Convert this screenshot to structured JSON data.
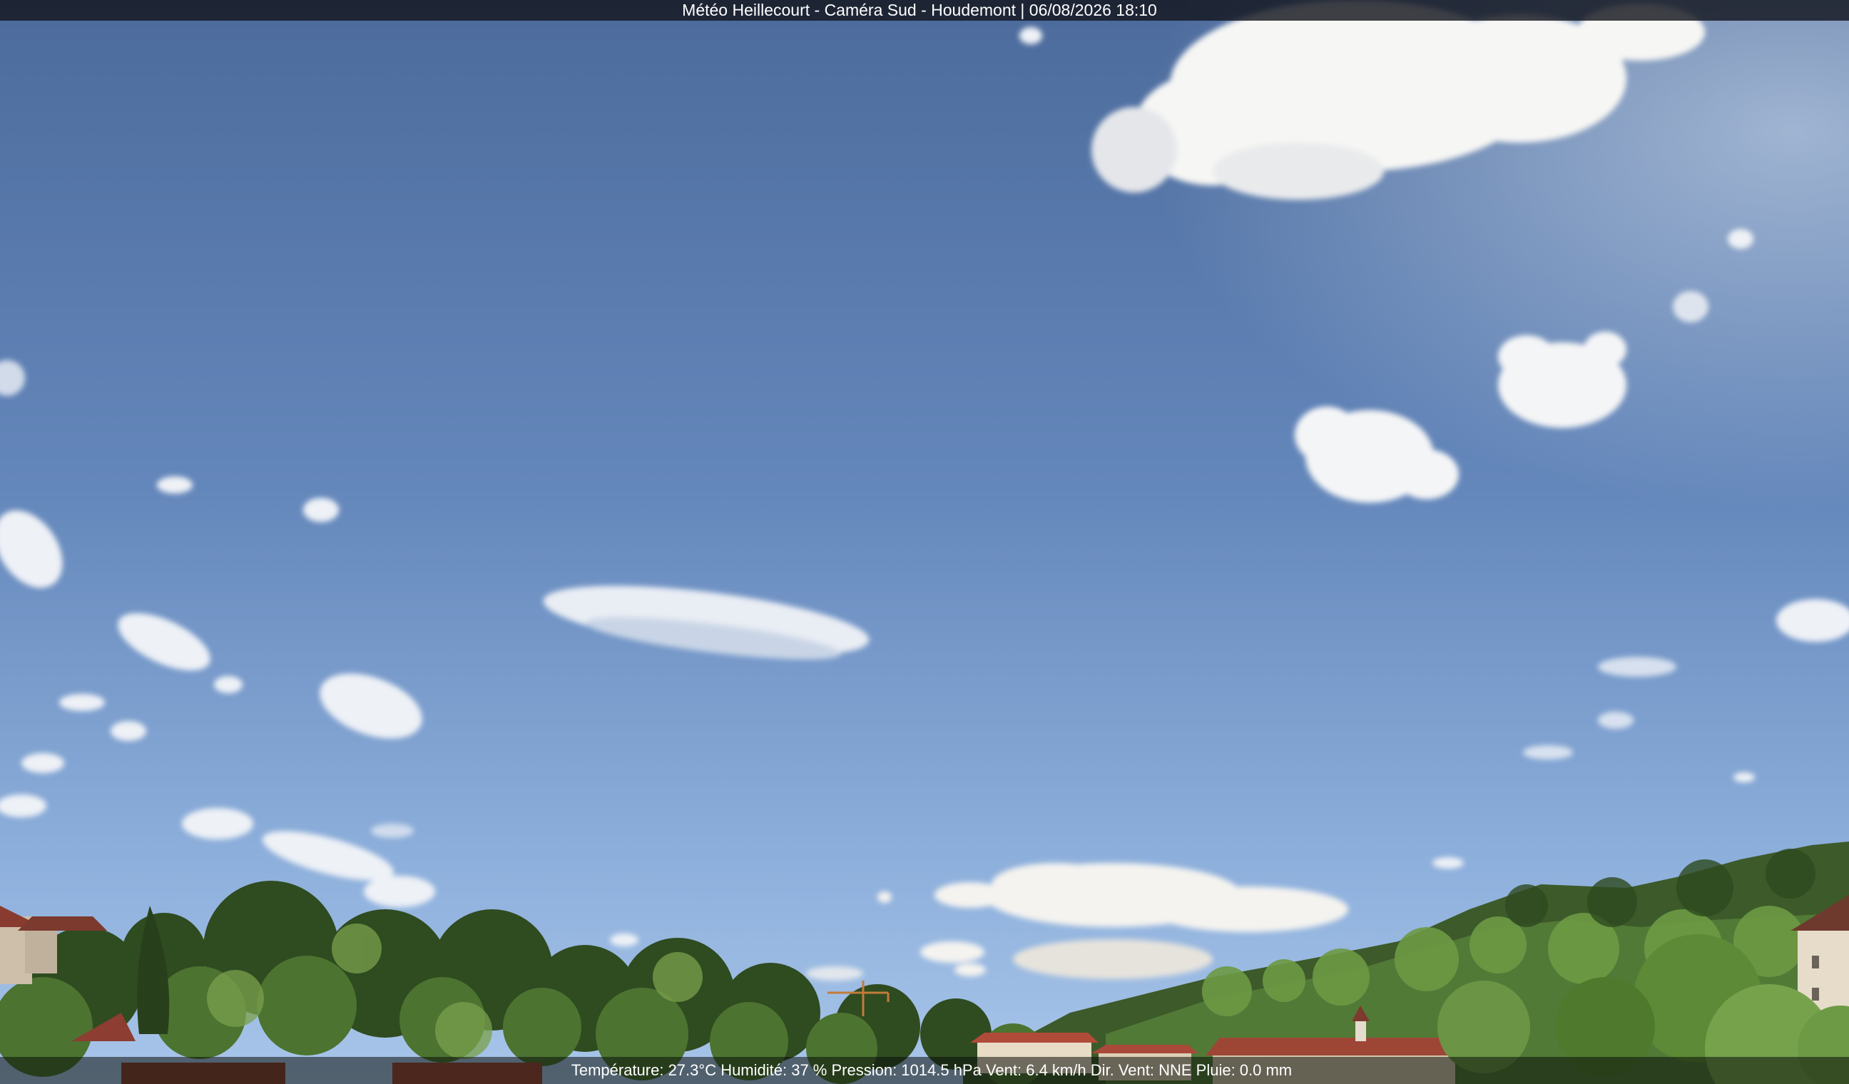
{
  "webcam": {
    "header": "Météo Heillecourt - Caméra Sud - Houdemont | 06/08/2026 18:10",
    "weather_line": "Température: 27.3°C  Humidité: 37 % Pression: 1014.5 hPa Vent: 6.4 km/h Dir. Vent: NNE Pluie: 0.0 mm"
  },
  "colors": {
    "sky_top": "#4f6f9f",
    "sky_bottom": "#9bbbe3",
    "cloud": "#ffffff",
    "foliage_dark": "#2f4a22",
    "foliage_light": "#5f8a3a",
    "roof": "#a9493a"
  }
}
